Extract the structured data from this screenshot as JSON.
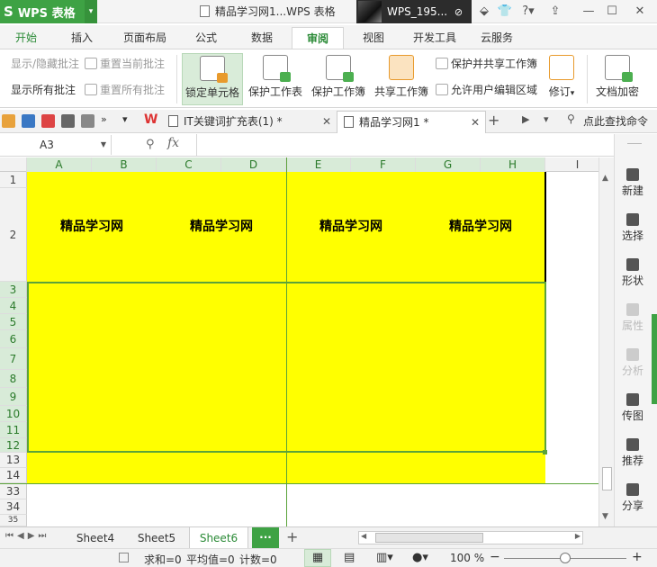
{
  "titlebar": {
    "app_name": "WPS 表格",
    "app_logo": "S",
    "document_title": "精品学习网1...WPS 表格",
    "account_name": "WPS_195...",
    "icons": [
      "minimize-icon",
      "maximize-icon",
      "close-icon"
    ]
  },
  "ribbon_tabs": [
    "开始",
    "插入",
    "页面布局",
    "公式",
    "数据",
    "审阅",
    "视图",
    "开发工具",
    "云服务"
  ],
  "ribbon_active_tab": "审阅",
  "ribbon": {
    "show_hide_comments": "显示/隐藏批注",
    "reset_current_comment": "重置当前批注",
    "show_all_comments": "显示所有批注",
    "reset_all_comments": "重置所有批注",
    "lock_cells": "锁定单元格",
    "protect_sheet": "保护工作表",
    "protect_workbook": "保护工作簿",
    "share_workbook": "共享工作簿",
    "protect_and_share": "保护并共享工作簿",
    "allow_edit_ranges": "允许用户编辑区域",
    "revisions": "修订",
    "doc_encrypt": "文档加密"
  },
  "doc_tabs": [
    {
      "label": "IT关键词扩充表(1) *",
      "active": false
    },
    {
      "label": "精品学习网1 *",
      "active": true
    }
  ],
  "quick_find": "点此查找命令",
  "formula_bar": {
    "name_box": "A3",
    "fx_label": "fx",
    "formula": ""
  },
  "grid": {
    "columns": [
      "A",
      "B",
      "C",
      "D",
      "E",
      "F",
      "G",
      "H",
      "I"
    ],
    "rows": [
      "1",
      "2",
      "3",
      "4",
      "5",
      "6",
      "7",
      "8",
      "9",
      "10",
      "11",
      "12",
      "13",
      "14",
      "33",
      "34",
      "35"
    ],
    "cell_texts": [
      "精品学习网",
      "精品学习网",
      "精品学习网",
      "精品学习网"
    ],
    "fill_color": "#ffff00",
    "selection_color": "#5aa33a"
  },
  "sheets": [
    "Sheet4",
    "Sheet5",
    "Sheet6"
  ],
  "active_sheet": "Sheet6",
  "status": {
    "sum": "求和=0",
    "average": "平均值=0",
    "count": "计数=0",
    "zoom": "100 %"
  },
  "sidebar": [
    "新建",
    "选择",
    "形状",
    "属性",
    "分析",
    "传图",
    "推荐",
    "分享"
  ]
}
